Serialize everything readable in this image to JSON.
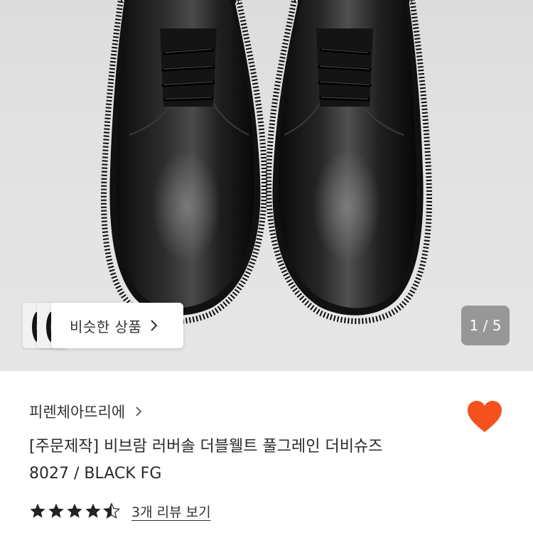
{
  "hero": {
    "image_alt": "black leather derby shoes",
    "similar_products_label": "비슷한 상품",
    "pager_text": "1 / 5"
  },
  "product": {
    "brand": "피렌체아뜨리에",
    "title_line1": "[주문제작] 비브람 러버솔 더블웰트 풀그레인 더비슈즈",
    "title_line2": "8027 / BLACK FG",
    "rating": 4.5,
    "rating_max": 5,
    "review_link": "3개 리뷰 보기",
    "wishlisted": true
  },
  "colors": {
    "heart": "#F4511E",
    "star": "#222222"
  }
}
